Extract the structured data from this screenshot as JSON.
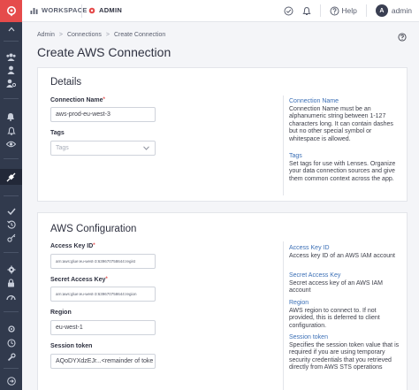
{
  "topbar": {
    "workspace_label": "WORKSPACE",
    "admin_label": "ADMIN",
    "help_label": "Help",
    "user_initial": "A",
    "user_name": "admin"
  },
  "breadcrumb": [
    "Admin",
    "Connections",
    "Create Connection"
  ],
  "page_title": "Create AWS Connection",
  "details": {
    "title": "Details",
    "connection_name_label": "Connection Name",
    "connection_name_value": "aws-prod-eu-west-3",
    "tags_label": "Tags",
    "tags_placeholder": "Tags",
    "help_connection_name_title": "Connection Name",
    "help_connection_name_body": "Connection Name must be an alphanumeric string between 1-127 characters long. It can contain dashes but no other special symbol or whitespace is allowed.",
    "help_tags_title": "Tags",
    "help_tags_body": "Set tags for use with Lenses. Organize your data connection sources and give them common context across the app."
  },
  "aws": {
    "title": "AWS Configuration",
    "access_key_label": "Access Key ID",
    "access_key_value": "arn:aws:glue:eu-west-3:639670758644:regist",
    "secret_key_label": "Secret Access Key",
    "secret_key_value": "arn:aws:glue:eu-west-3:639670758644:region",
    "region_label": "Region",
    "region_value": "eu-west-1",
    "session_token_label": "Session token",
    "session_token_value": "AQoDYXdzEJr...<remainder of toke",
    "help_access_key_title": "Access Key ID",
    "help_access_key_body": "Access key ID of an AWS IAM account",
    "help_secret_key_title": "Secret Access Key",
    "help_secret_key_body": "Secret access key of an AWS IAM account",
    "help_region_title": "Region",
    "help_region_body": "AWS region to connect to. If not provided, this is deferred to client configuration.",
    "help_session_title": "Session token",
    "help_session_body": "Specifies the session token value that is required if you are using temporary security credentials that you retrieved directly from AWS STS operations"
  },
  "colors": {
    "brand": "#e54b4b",
    "sidebar": "#313a4d",
    "link": "#3b6fb6"
  }
}
